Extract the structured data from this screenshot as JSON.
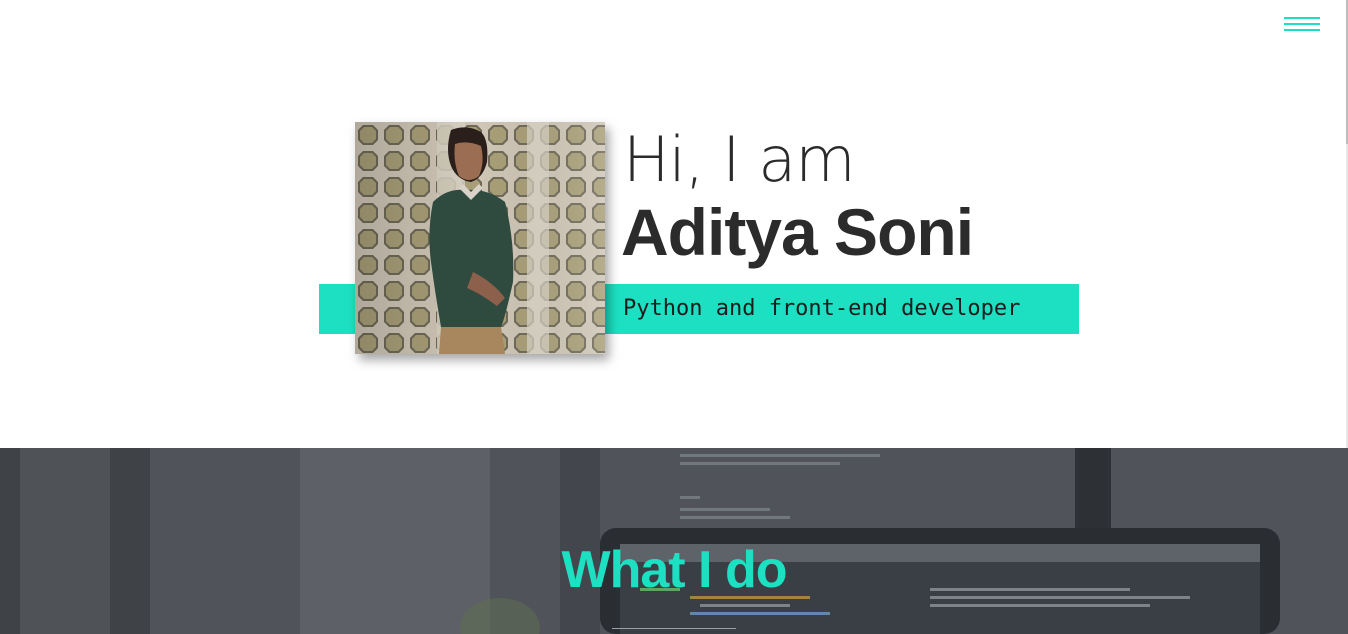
{
  "nav": {
    "menu_icon": "hamburger-menu-icon",
    "accent_color": "#1de0c2"
  },
  "hero": {
    "greeting": "Hi, I am",
    "name": "Aditya Soni",
    "role": "Python and front-end developer",
    "photo_icon": "profile-photo"
  },
  "what_i_do": {
    "title": "What I do",
    "background_icon": "laptop-workspace-photo"
  },
  "colors": {
    "accent": "#1de0c2",
    "text": "#2b2b2b",
    "section_bg": "#4e5258"
  }
}
